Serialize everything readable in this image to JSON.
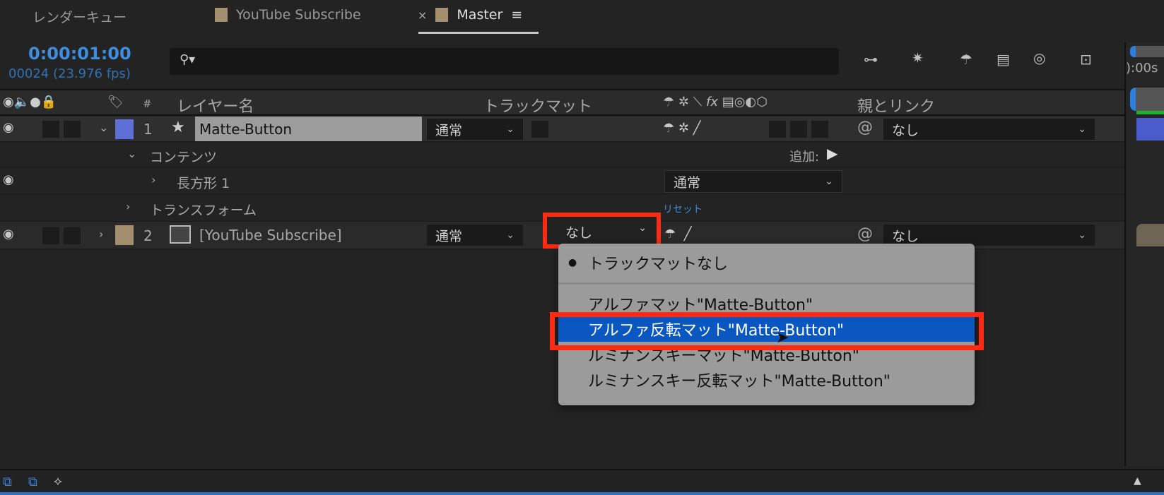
{
  "tabs": {
    "render_queue": "レンダーキュー",
    "comp1": "YouTube Subscribe",
    "close": "×",
    "comp2": "Master",
    "menu": "≡"
  },
  "time": {
    "timecode": "0:00:01:00",
    "frames": "00024 (23.976 fps)"
  },
  "search": {
    "placeholder": ""
  },
  "headers": {
    "hash": "#",
    "layer_name": "レイヤー名",
    "track_matte": "トラックマット",
    "fx": "fx",
    "parent": "親とリンク"
  },
  "timeline": {
    "ruler": "):00s"
  },
  "layers": [
    {
      "num": "1",
      "name": "Matte-Button",
      "mode": "通常",
      "parent": "なし",
      "color": "#5e6fd8"
    },
    {
      "num": "2",
      "name": "[YouTube Subscribe]",
      "mode": "通常",
      "matte": "なし",
      "parent": "なし",
      "color": "#a38e6e"
    }
  ],
  "sub": {
    "contents": "コンテンツ",
    "add": "追加:",
    "rect": "長方形 1",
    "rect_mode": "通常",
    "transform": "トランスフォーム",
    "reset": "リセット"
  },
  "menu": {
    "items": [
      "トラックマットなし",
      "アルファマット\"Matte-Button\"",
      "アルファ反転マット\"Matte-Button\"",
      "ルミナンスキーマット\"Matte-Button\"",
      "ルミナンスキー反転マット\"Matte-Button\""
    ],
    "selected_index": 2,
    "checked_index": 0,
    "highlight": "#0a57c2"
  },
  "colors": {
    "accent": "#3d8ee0",
    "annotation": "#ff2a10"
  }
}
